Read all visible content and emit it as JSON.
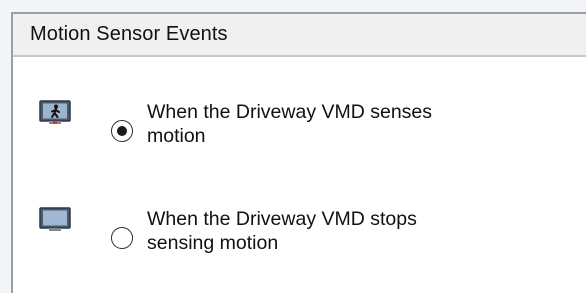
{
  "panel": {
    "title": "Motion Sensor Events"
  },
  "events": [
    {
      "icon": "camera-motion-icon",
      "line1": "When the Driveway VMD senses",
      "line2": "motion",
      "selected": true
    },
    {
      "icon": "camera-idle-icon",
      "line1": "When the Driveway VMD stops",
      "line2": "sensing motion",
      "selected": false
    }
  ]
}
